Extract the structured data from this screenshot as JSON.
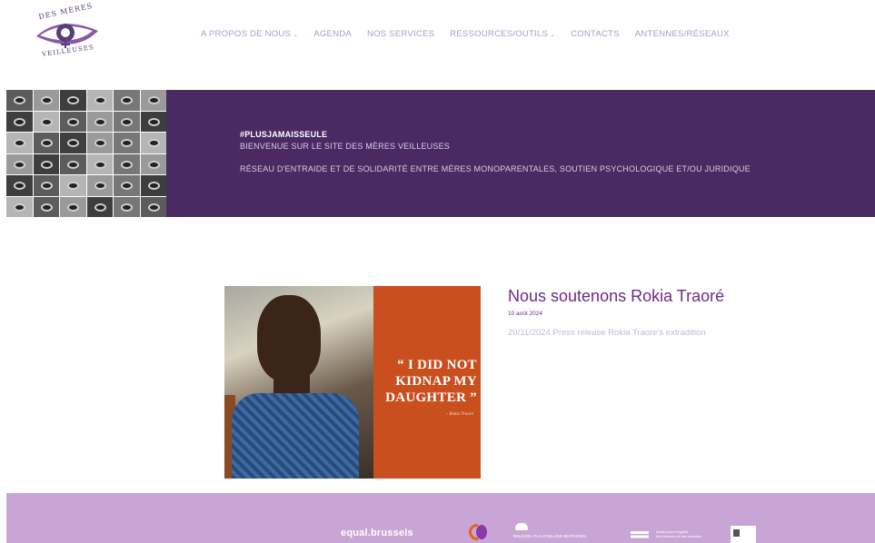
{
  "logo": {
    "text_top": "DES MÈRES",
    "text_bottom": "VEILLEUSES",
    "colors": {
      "primary": "#5a3d7a",
      "accent": "#8a5aa8"
    }
  },
  "nav": {
    "items": [
      {
        "label": "A PROPOS DE NOUS",
        "has_dropdown": true
      },
      {
        "label": "AGENDA",
        "has_dropdown": false
      },
      {
        "label": "NOS SERVICES",
        "has_dropdown": false
      },
      {
        "label": "RESSOURCES/OUTILS",
        "has_dropdown": true
      },
      {
        "label": "CONTACTS",
        "has_dropdown": false
      },
      {
        "label": "ANTENNES/RÉSEAUX",
        "has_dropdown": false
      }
    ],
    "chevron": "⌄"
  },
  "hero": {
    "hashtag": "#PLUSJAMAISSEULE",
    "welcome": "BIENVENUE SUR LE SITE DES MÈRES VEILLEUSES",
    "tagline": "RÉSEAU D'ENTRAIDE ET DE SOLIDARITÉ ENTRE MÈRES MONOPARENTALES, SOUTIEN PSYCHOLOGIQUE ET/OU JURIDIQUE",
    "background_color": "#4b2a63"
  },
  "post": {
    "title": "Nous soutenons Rokia Traoré",
    "date": "10 août 2024",
    "excerpt": "20/11/2024 Press release Rokia Traore's extradition",
    "image_quote_line1": "“ I DID NOT",
    "image_quote_line2": "KIDNAP MY",
    "image_quote_line3": "DAUGHTER ”",
    "image_quote_author": "- Rokia Traoré",
    "accent_color": "#c94f1f"
  },
  "footer": {
    "background_color": "#c9a5d6",
    "partners": {
      "equal": "equal.brussels",
      "brussel_line1": "BRUSSEL PLAATSELIJKE BESTUREN",
      "iefh_line1": "Institut pour l'égalité",
      "iefh_line2": "des femmes et des hommes"
    }
  }
}
